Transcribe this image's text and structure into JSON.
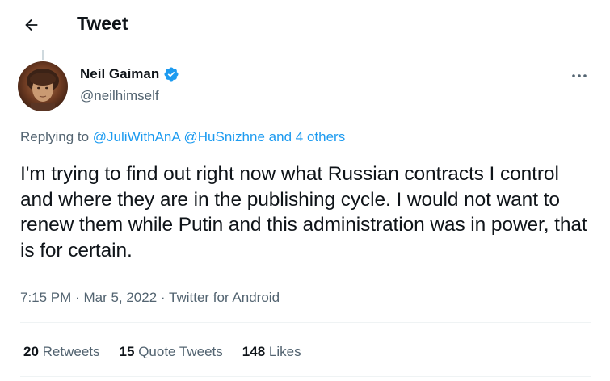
{
  "header": {
    "title": "Tweet",
    "back_icon": "arrow-left-icon"
  },
  "author": {
    "name": "Neil Gaiman",
    "handle": "@neilhimself",
    "verified_icon": "verified-badge-icon",
    "verified_color": "#1d9bf0"
  },
  "reply": {
    "prefix": "Replying to",
    "mention1": "@JuliWithAnA",
    "mention2": "@HuSnizhne",
    "joiner": "and",
    "others": "4 others"
  },
  "tweet": {
    "text": "I'm trying to find out right now what Russian contracts I control and where they are in the publishing cycle. I would not want to renew them while Putin and this administration was in power, that is for certain."
  },
  "meta": {
    "time": "7:15 PM",
    "separator": "·",
    "date": "Mar 5, 2022",
    "source": "Twitter for Android"
  },
  "stats": {
    "retweets_count": "20",
    "retweets_label": "Retweets",
    "quotes_count": "15",
    "quotes_label": "Quote Tweets",
    "likes_count": "148",
    "likes_label": "Likes"
  },
  "colors": {
    "accent": "#1d9bf0",
    "text_primary": "#0f1419",
    "text_secondary": "#536471"
  }
}
